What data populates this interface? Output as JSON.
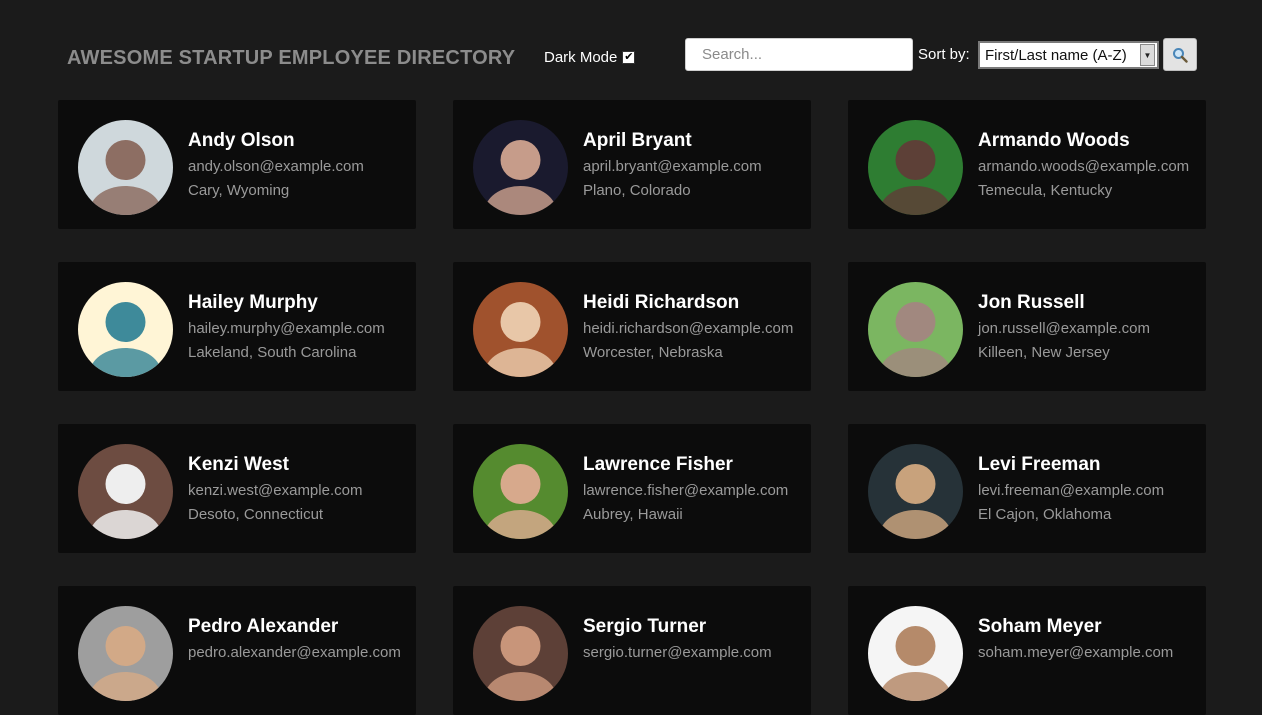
{
  "header": {
    "title": "AWESOME STARTUP EMPLOYEE DIRECTORY",
    "dark_mode_label": "Dark Mode",
    "dark_mode_checked": true,
    "search_placeholder": "Search...",
    "sort_label": "Sort by:",
    "sort_value": "First/Last name (A-Z)",
    "search_button_icon": "magnifier-icon"
  },
  "employees": [
    {
      "name": "Andy Olson",
      "email": "andy.olson@example.com",
      "location": "Cary, Wyoming",
      "avatar_colors": [
        "#cfd8dc",
        "#8d6e63"
      ]
    },
    {
      "name": "April Bryant",
      "email": "april.bryant@example.com",
      "location": "Plano, Colorado",
      "avatar_colors": [
        "#1a1a2e",
        "#c69c8a"
      ]
    },
    {
      "name": "Armando Woods",
      "email": "armando.woods@example.com",
      "location": "Temecula, Kentucky",
      "avatar_colors": [
        "#2e7d32",
        "#5d4037"
      ]
    },
    {
      "name": "Hailey Murphy",
      "email": "hailey.murphy@example.com",
      "location": "Lakeland, South Carolina",
      "avatar_colors": [
        "#fff5d6",
        "#3e8a9a"
      ]
    },
    {
      "name": "Heidi Richardson",
      "email": "heidi.richardson@example.com",
      "location": "Worcester, Nebraska",
      "avatar_colors": [
        "#a0522d",
        "#e8c7a8"
      ]
    },
    {
      "name": "Jon Russell",
      "email": "jon.russell@example.com",
      "location": "Killeen, New Jersey",
      "avatar_colors": [
        "#7bb661",
        "#a1887f"
      ]
    },
    {
      "name": "Kenzi West",
      "email": "kenzi.west@example.com",
      "location": "Desoto, Connecticut",
      "avatar_colors": [
        "#6d4c41",
        "#eeeeee"
      ]
    },
    {
      "name": "Lawrence Fisher",
      "email": "lawrence.fisher@example.com",
      "location": "Aubrey, Hawaii",
      "avatar_colors": [
        "#558b2f",
        "#d7a98c"
      ]
    },
    {
      "name": "Levi Freeman",
      "email": "levi.freeman@example.com",
      "location": "El Cajon, Oklahoma",
      "avatar_colors": [
        "#263238",
        "#c8a27c"
      ]
    },
    {
      "name": "Pedro Alexander",
      "email": "pedro.alexander@example.com",
      "location": "",
      "avatar_colors": [
        "#9e9e9e",
        "#d2a987"
      ]
    },
    {
      "name": "Sergio Turner",
      "email": "sergio.turner@example.com",
      "location": "",
      "avatar_colors": [
        "#5d4037",
        "#c8957a"
      ]
    },
    {
      "name": "Soham Meyer",
      "email": "soham.meyer@example.com",
      "location": "",
      "avatar_colors": [
        "#f5f5f5",
        "#b58a6a"
      ]
    }
  ]
}
